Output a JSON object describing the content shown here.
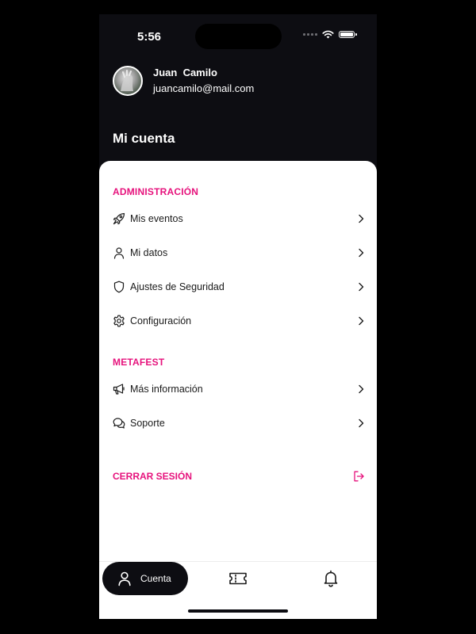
{
  "status_bar": {
    "time": "5:56"
  },
  "profile": {
    "name": "Juan  Camilo",
    "email": "juancamilo@mail.com"
  },
  "page_title": "Mi cuenta",
  "sections": {
    "admin": {
      "title": "ADMINISTRACIÓN",
      "items": [
        {
          "label": "Mis eventos",
          "icon": "rocket-icon"
        },
        {
          "label": "Mi datos",
          "icon": "user-icon"
        },
        {
          "label": "Ajustes de Seguridad",
          "icon": "shield-icon"
        },
        {
          "label": "Configuración",
          "icon": "gear-icon"
        }
      ]
    },
    "metafest": {
      "title": "METAFEST",
      "items": [
        {
          "label": "Más información",
          "icon": "megaphone-icon"
        },
        {
          "label": "Soporte",
          "icon": "chat-bubbles-icon"
        }
      ]
    }
  },
  "logout": {
    "label": "CERRAR SESIÓN",
    "icon": "logout-icon"
  },
  "tabbar": {
    "active_label": "Cuenta",
    "tabs": [
      {
        "name": "Cuenta",
        "icon": "user-icon"
      },
      {
        "icon": "ticket-icon"
      },
      {
        "icon": "bell-icon"
      }
    ]
  },
  "colors": {
    "accent": "#e6127c",
    "dark": "#0d0d12",
    "sheet": "#ffffff"
  }
}
